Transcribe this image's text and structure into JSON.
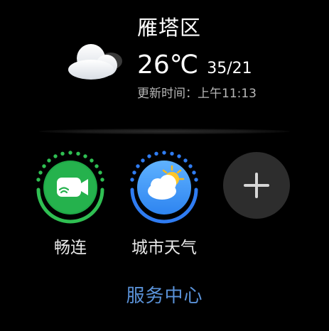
{
  "weather": {
    "location": "雁塔区",
    "temperature": "26℃",
    "range": "35/21",
    "updated": "更新时间：上午11:13",
    "icon": "cloud-icon"
  },
  "apps": [
    {
      "label": "畅连",
      "icon": "changlian-video-icon",
      "accent": "#2fbf52"
    },
    {
      "label": "城市天气",
      "icon": "city-weather-icon",
      "accent": "#2f7cf2"
    }
  ],
  "add_icon": "plus-icon",
  "footer": {
    "label": "服务中心"
  },
  "colors": {
    "background": "#000000",
    "service_link": "#5a92d8",
    "add_button": "#2d2d2d"
  }
}
